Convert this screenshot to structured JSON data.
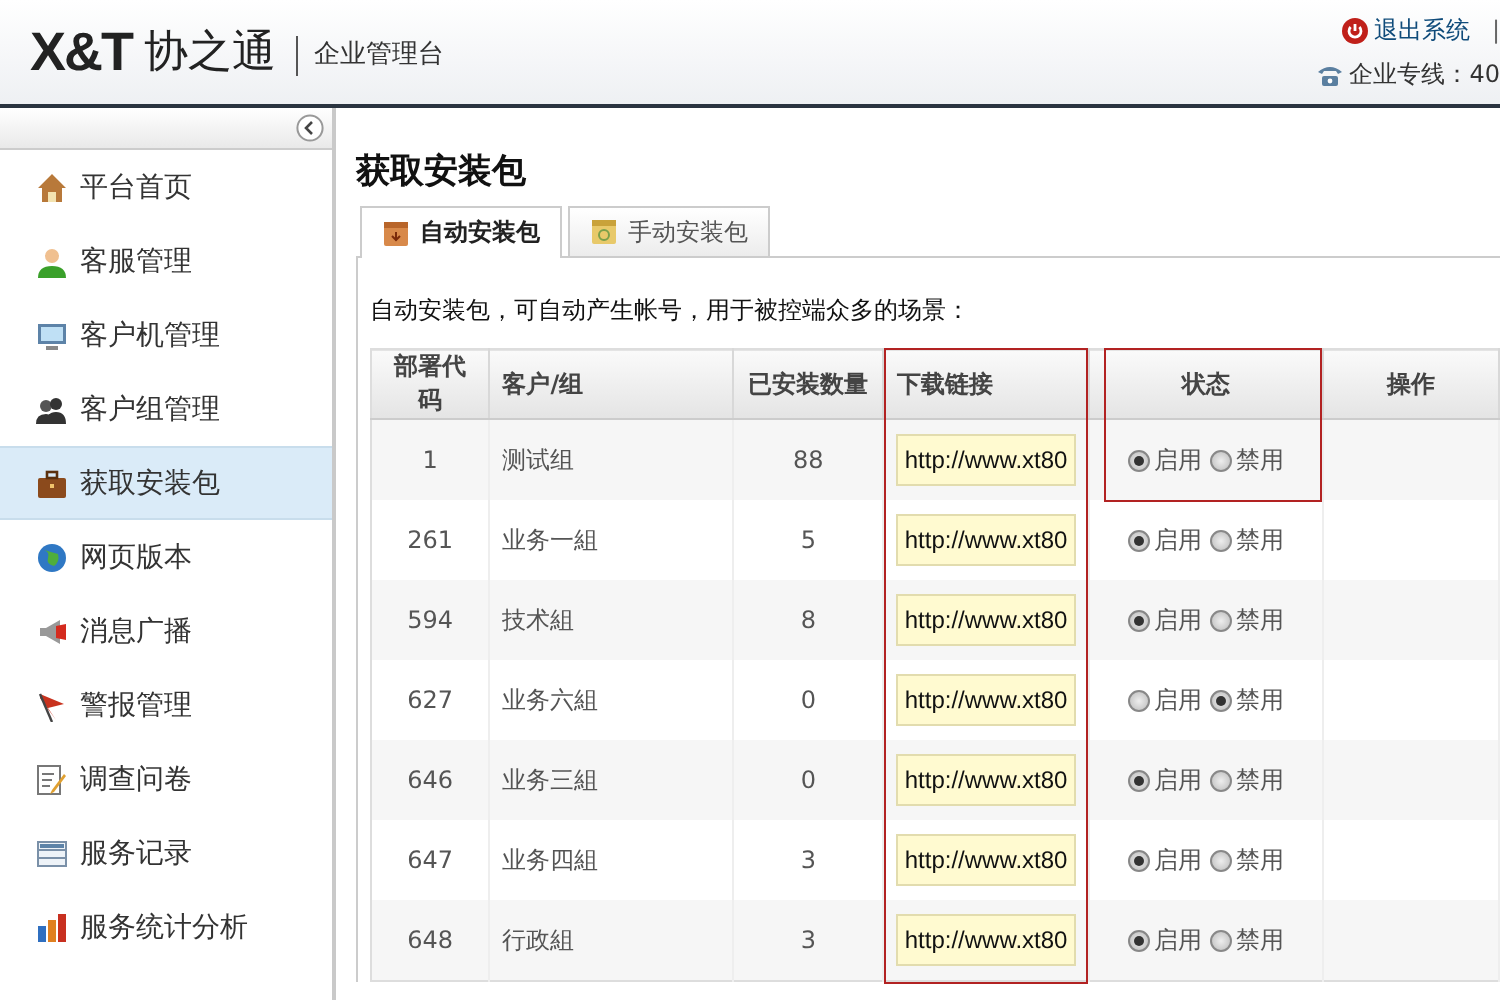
{
  "header": {
    "logo": "X&T",
    "brand": "协之通",
    "subtitle": "企业管理台",
    "logout": "退出系统",
    "separator": "|",
    "hotline": "企业专线：40"
  },
  "sidebar": {
    "items": [
      {
        "label": "平台首页",
        "selected": false
      },
      {
        "label": "客服管理",
        "selected": false
      },
      {
        "label": "客户机管理",
        "selected": false
      },
      {
        "label": "客户组管理",
        "selected": false
      },
      {
        "label": "获取安装包",
        "selected": true
      },
      {
        "label": "网页版本",
        "selected": false
      },
      {
        "label": "消息广播",
        "selected": false
      },
      {
        "label": "警报管理",
        "selected": false
      },
      {
        "label": "调查问卷",
        "selected": false
      },
      {
        "label": "服务记录",
        "selected": false
      },
      {
        "label": "服务统计分析",
        "selected": false
      }
    ]
  },
  "page": {
    "title": "获取安装包",
    "tabs": [
      {
        "label": "自动安装包",
        "selected": true
      },
      {
        "label": "手动安装包",
        "selected": false
      }
    ],
    "description": "自动安装包，可自动产生帐号，用于被控端众多的场景：",
    "table": {
      "columns": [
        "部署代码",
        "客户/组",
        "已安装数量",
        "下载链接",
        "状态",
        "操作"
      ],
      "rows": [
        {
          "code": "1",
          "group": "测试组",
          "installed": "88",
          "link": "http://www.xt80",
          "status": [
            {
              "label": "启用",
              "selected": true
            },
            {
              "label": "禁用",
              "selected": false
            }
          ]
        },
        {
          "code": "261",
          "group": "业务一組",
          "installed": "5",
          "link": "http://www.xt80",
          "status": [
            {
              "label": "启用",
              "selected": true
            },
            {
              "label": "禁用",
              "selected": false
            }
          ]
        },
        {
          "code": "594",
          "group": "技术組",
          "installed": "8",
          "link": "http://www.xt80",
          "status": [
            {
              "label": "启用",
              "selected": true
            },
            {
              "label": "禁用",
              "selected": false
            }
          ]
        },
        {
          "code": "627",
          "group": "业务六組",
          "installed": "0",
          "link": "http://www.xt80",
          "status": [
            {
              "label": "启用",
              "selected": false
            },
            {
              "label": "禁用",
              "selected": true
            }
          ]
        },
        {
          "code": "646",
          "group": "业务三組",
          "installed": "0",
          "link": "http://www.xt80",
          "status": [
            {
              "label": "启用",
              "selected": true
            },
            {
              "label": "禁用",
              "selected": false
            }
          ]
        },
        {
          "code": "647",
          "group": "业务四組",
          "installed": "3",
          "link": "http://www.xt80",
          "status": [
            {
              "label": "启用",
              "selected": true
            },
            {
              "label": "禁用",
              "selected": false
            }
          ]
        },
        {
          "code": "648",
          "group": "行政組",
          "installed": "3",
          "link": "http://www.xt80",
          "status": [
            {
              "label": "启用",
              "selected": true
            },
            {
              "label": "禁用",
              "selected": false
            }
          ]
        }
      ]
    }
  }
}
